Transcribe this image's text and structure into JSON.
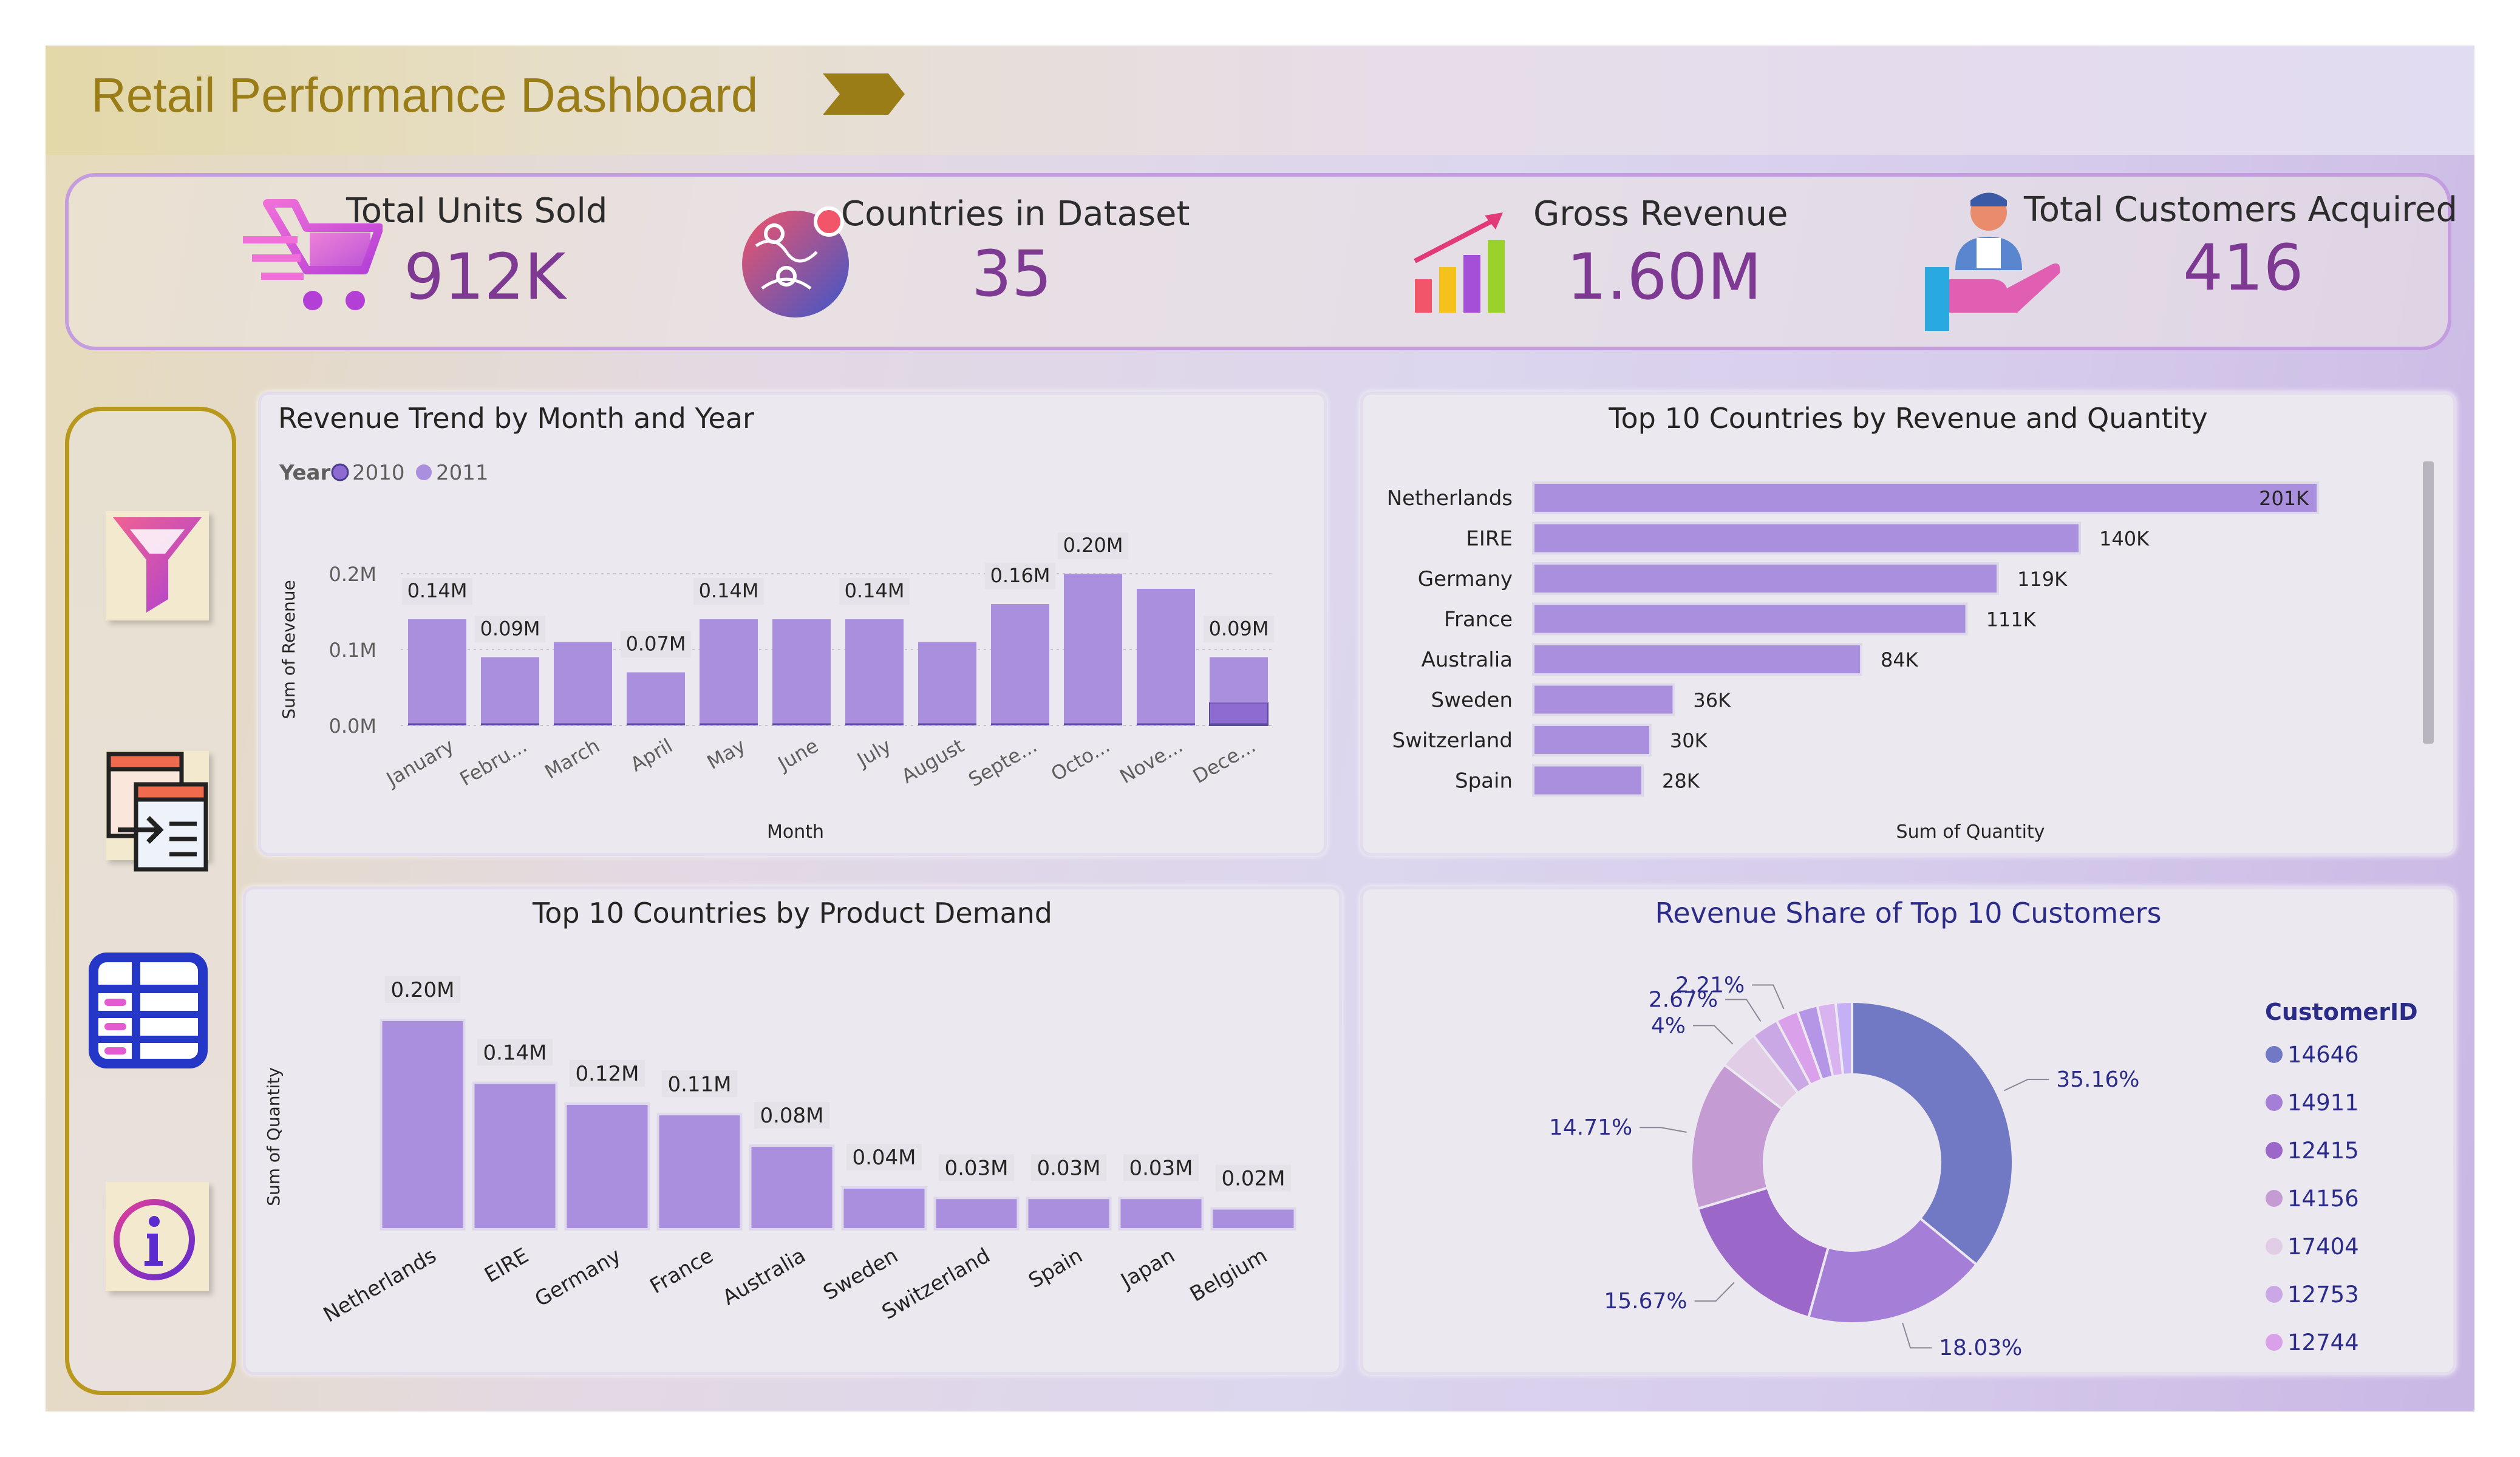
{
  "header": {
    "title": "Retail Performance Dashboard",
    "arrow_icon": "chevron-right-icon",
    "title_color": "#9a7d16"
  },
  "kpis": [
    {
      "label": "Total Units Sold",
      "value": "912K",
      "icon": "shopping-cart-icon"
    },
    {
      "label": "Countries in Dataset",
      "value": "35",
      "icon": "globe-map-icon"
    },
    {
      "label": "Gross Revenue",
      "value": "1.60M",
      "icon": "growth-chart-icon"
    },
    {
      "label": "Total Customers Acquired",
      "value": "416",
      "icon": "customer-hand-icon"
    }
  ],
  "sidebar": {
    "buttons": [
      {
        "name": "filter-button",
        "icon": "filter-icon"
      },
      {
        "name": "export-button",
        "icon": "export-icon"
      },
      {
        "name": "table-button",
        "icon": "table-icon"
      },
      {
        "name": "info-button",
        "icon": "info-icon"
      }
    ]
  },
  "colors": {
    "bar": "#a98fdd",
    "bar_dark": "#8e6bd0",
    "kpi_value": "#7e3a92",
    "donut": [
      "#7279c4",
      "#a57ed8",
      "#9b67c9",
      "#c59bd3",
      "#e2cde6",
      "#caa8e6",
      "#dba0ea",
      "#b595e6",
      "#d8b3ef",
      "#c6b0f5"
    ]
  },
  "chart_data": [
    {
      "id": "revenue_trend",
      "type": "bar",
      "title": "Revenue Trend by Month and Year",
      "xlabel": "Month",
      "ylabel": "Sum of Revenue",
      "legend_title": "Year",
      "legend_position": "top-left",
      "grid": true,
      "ylim": [
        0,
        0.2
      ],
      "yticks": [
        "0.0M",
        "0.1M",
        "0.2M"
      ],
      "categories": [
        "January",
        "Febru...",
        "March",
        "April",
        "May",
        "June",
        "July",
        "August",
        "Septe...",
        "Octo...",
        "Nove...",
        "Dece..."
      ],
      "series": [
        {
          "name": "2010",
          "values": [
            0,
            0,
            0,
            0,
            0,
            0,
            0,
            0,
            0,
            0,
            0,
            0.03
          ]
        },
        {
          "name": "2011",
          "values": [
            0.14,
            0.09,
            0.11,
            0.07,
            0.14,
            0.14,
            0.14,
            0.11,
            0.16,
            0.2,
            0.18,
            0.06
          ]
        }
      ],
      "totals": [
        0.14,
        0.09,
        0.11,
        0.07,
        0.14,
        0.14,
        0.14,
        0.11,
        0.16,
        0.2,
        0.18,
        0.09
      ],
      "data_labels": [
        "0.14M",
        "0.09M",
        "",
        "0.07M",
        "0.14M",
        "",
        "0.14M",
        "",
        "0.16M",
        "0.20M",
        "",
        "0.09M"
      ]
    },
    {
      "id": "top_countries_rev_qty",
      "type": "bar",
      "orientation": "horizontal",
      "title": "Top 10 Countries by Revenue and Quantity",
      "xlabel": "Sum of Quantity",
      "categories": [
        "Netherlands",
        "EIRE",
        "Germany",
        "France",
        "Australia",
        "Sweden",
        "Switzerland",
        "Spain"
      ],
      "values": [
        201,
        140,
        119,
        111,
        84,
        36,
        30,
        28
      ],
      "data_labels": [
        "201K",
        "140K",
        "119K",
        "111K",
        "84K",
        "36K",
        "30K",
        "28K"
      ],
      "xlim": [
        0,
        210
      ]
    },
    {
      "id": "product_demand",
      "type": "bar",
      "title": "Top 10 Countries by Product Demand",
      "ylabel": "Sum of Quantity",
      "categories": [
        "Netherlands",
        "EIRE",
        "Germany",
        "France",
        "Australia",
        "Sweden",
        "Switzerland",
        "Spain",
        "Japan",
        "Belgium"
      ],
      "values": [
        0.2,
        0.14,
        0.12,
        0.11,
        0.08,
        0.04,
        0.03,
        0.03,
        0.03,
        0.02
      ],
      "data_labels": [
        "0.20M",
        "0.14M",
        "0.12M",
        "0.11M",
        "0.08M",
        "0.04M",
        "0.03M",
        "0.03M",
        "0.03M",
        "0.02M"
      ],
      "ylim": [
        0,
        0.2
      ]
    },
    {
      "id": "customer_share",
      "type": "pie",
      "donut": true,
      "title": "Revenue Share of Top 10 Customers",
      "legend_title": "CustomerID",
      "legend_position": "right",
      "labels": [
        "14646",
        "14911",
        "12415",
        "14156",
        "17404",
        "12753",
        "12744"
      ],
      "values": [
        35.16,
        18.03,
        15.67,
        14.71,
        4.0,
        2.67,
        2.21,
        2.0,
        1.8,
        1.6
      ],
      "data_labels": [
        "35.16%",
        "18.03%",
        "15.67%",
        "14.71%",
        "4%",
        "2.67%",
        "2.21%",
        "",
        "",
        ""
      ],
      "more_icon": "caret-down-icon"
    }
  ]
}
